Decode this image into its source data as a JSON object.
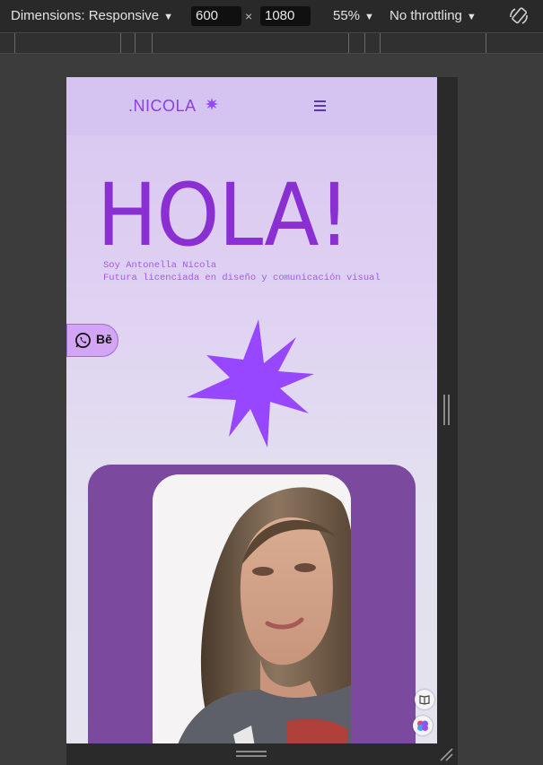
{
  "devtools": {
    "dimensions_label": "Dimensions: Responsive",
    "width_value": "600",
    "height_value": "1080",
    "times_symbol": "×",
    "zoom_label": "55%",
    "throttling_label": "No throttling",
    "caret": "▼"
  },
  "site": {
    "brand": ".NICOLA",
    "hero_title": "HOLA!",
    "subtitle_line1": "Soy Antonella Nicola",
    "subtitle_line2": "Futura licenciada en diseño y comunicación visual",
    "social": {
      "behance_label": "Bē"
    },
    "colors": {
      "accent": "#8a2fd1",
      "star": "#9747ff",
      "card": "#7b4a9f"
    }
  }
}
